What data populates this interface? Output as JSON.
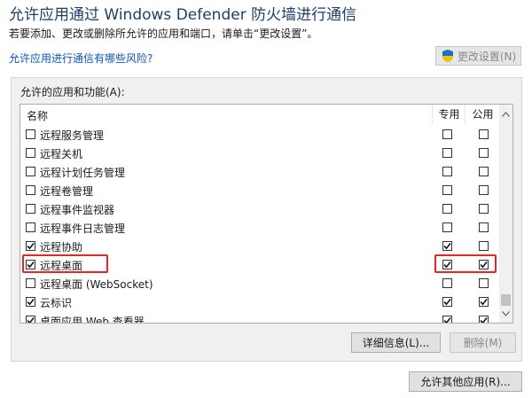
{
  "header": {
    "title": "允许应用通过 Windows Defender 防火墙进行通信",
    "subtitle": "若要添加、更改或删除所允许的应用和端口，请单击“更改设置”。",
    "risk_link": "允许应用进行通信有哪些风险?",
    "change_settings_label": "更改设置(N)"
  },
  "group": {
    "label": "允许的应用和功能(A):",
    "columns": {
      "name": "名称",
      "private": "专用",
      "public": "公用"
    },
    "rows": [
      {
        "name": "远程服务管理",
        "enabled": false,
        "private": false,
        "public": false
      },
      {
        "name": "远程关机",
        "enabled": false,
        "private": false,
        "public": false
      },
      {
        "name": "远程计划任务管理",
        "enabled": false,
        "private": false,
        "public": false
      },
      {
        "name": "远程卷管理",
        "enabled": false,
        "private": false,
        "public": false
      },
      {
        "name": "远程事件监视器",
        "enabled": false,
        "private": false,
        "public": false
      },
      {
        "name": "远程事件日志管理",
        "enabled": false,
        "private": false,
        "public": false
      },
      {
        "name": "远程协助",
        "enabled": true,
        "private": true,
        "public": false
      },
      {
        "name": "远程桌面",
        "enabled": true,
        "private": true,
        "public": true
      },
      {
        "name": "远程桌面 (WebSocket)",
        "enabled": false,
        "private": false,
        "public": false
      },
      {
        "name": "云标识",
        "enabled": true,
        "private": true,
        "public": true
      },
      {
        "name": "桌面应用 Web 查看器",
        "enabled": true,
        "private": true,
        "public": true
      }
    ],
    "details_label": "详细信息(L)...",
    "delete_label": "删除(M)"
  },
  "footer": {
    "allow_other_label": "允许其他应用(R)..."
  },
  "colors": {
    "title": "#1e3f66",
    "link": "#0a56b3",
    "highlight": "#e02828"
  }
}
